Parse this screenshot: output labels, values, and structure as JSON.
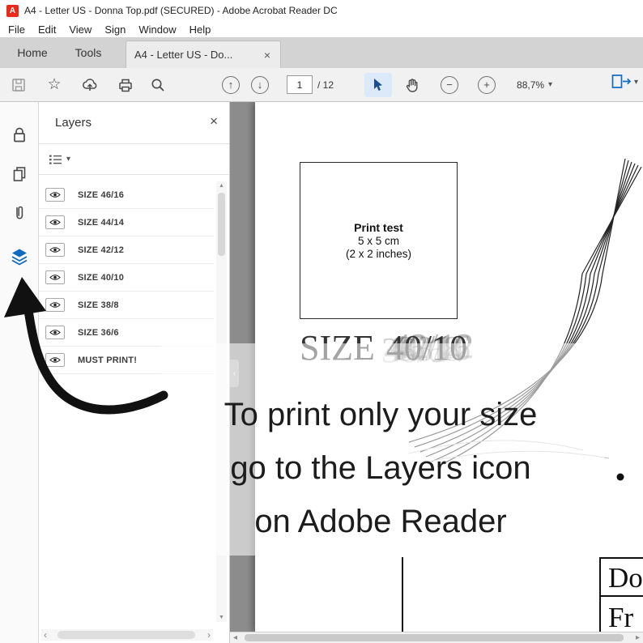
{
  "colors": {
    "accent_blue": "#0d6cbf",
    "adobe_red": "#e8291c",
    "annotation_ink": "#111111"
  },
  "icons": {
    "adobe_letter": "A",
    "caret": "▾",
    "close": "×",
    "scroll_up": "▲",
    "scroll_down": "▼",
    "chev_left": "‹",
    "chev_right": "›",
    "tri_left": "◂",
    "tri_right": "▸"
  },
  "titlebar": {
    "title": "A4 - Letter US - Donna Top.pdf (SECURED) - Adobe Acrobat Reader DC"
  },
  "menubar": {
    "items": [
      "File",
      "Edit",
      "View",
      "Sign",
      "Window",
      "Help"
    ]
  },
  "tabbar": {
    "home": "Home",
    "tools": "Tools",
    "document_tab": "A4 - Letter US - Do..."
  },
  "toolbar": {
    "page_current": "1",
    "page_total": "/ 12",
    "zoom_value": "88,7%"
  },
  "layers_panel": {
    "title": "Layers",
    "items": [
      "SIZE 46/16",
      "SIZE 44/14",
      "SIZE 42/12",
      "SIZE 40/10",
      "SIZE 38/8",
      "SIZE 36/6",
      "MUST PRINT!"
    ]
  },
  "document": {
    "print_test_line1": "Print test",
    "print_test_line2": "5 x 5 cm",
    "print_test_line3": "(2 x 2 inches)",
    "size_word": "SIZE",
    "size_main": "40/10",
    "size_ghosts": [
      "46/16",
      "44/14",
      "42/12",
      "38/8",
      "36/6"
    ],
    "corner_line1": "Do",
    "corner_line2": "Fr"
  },
  "annotation": {
    "line1": "To print only your size",
    "line2": "go to the Layers icon",
    "line3": "on Adobe Reader"
  }
}
